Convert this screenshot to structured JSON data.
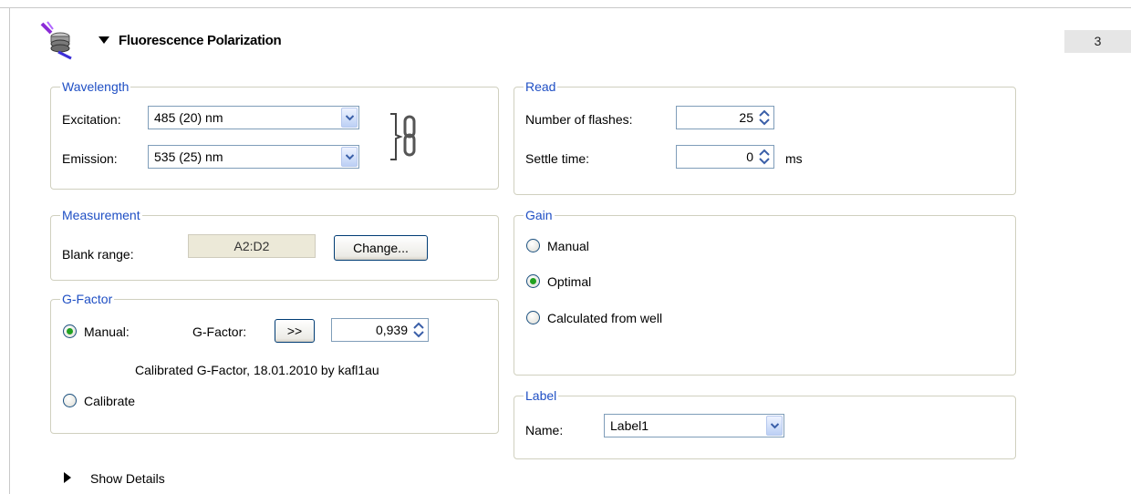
{
  "header": {
    "title": "Fluorescence Polarization",
    "step_number": "3",
    "icon": "fluorescence-lamp-icon"
  },
  "wavelength": {
    "legend": "Wavelength",
    "excitation_label": "Excitation:",
    "excitation_value": "485 (20) nm",
    "emission_label": "Emission:",
    "emission_value": "535 (25) nm",
    "link_icon": "chain-link-icon"
  },
  "measurement": {
    "legend": "Measurement",
    "blank_range_label": "Blank range:",
    "blank_range_value": "A2:D2",
    "change_button": "Change..."
  },
  "gfactor": {
    "legend": "G-Factor",
    "manual_label": "Manual:",
    "manual_selected": true,
    "gfactor_label": "G-Factor:",
    "apply_button": ">>",
    "gfactor_value": "0,939",
    "calibration_info": "Calibrated G-Factor, 18.01.2010 by kafl1au",
    "calibrate_label": "Calibrate",
    "calibrate_selected": false
  },
  "read": {
    "legend": "Read",
    "flashes_label": "Number of flashes:",
    "flashes_value": "25",
    "settle_label": "Settle time:",
    "settle_value": "0",
    "settle_unit": "ms"
  },
  "gain": {
    "legend": "Gain",
    "options": [
      {
        "label": "Manual",
        "selected": false
      },
      {
        "label": "Optimal",
        "selected": true
      },
      {
        "label": "Calculated from well",
        "selected": false
      }
    ]
  },
  "label_group": {
    "legend": "Label",
    "name_label": "Name:",
    "name_value": "Label1"
  },
  "footer": {
    "show_details": "Show Details"
  },
  "colors": {
    "legend_text": "#1f4fc4",
    "group_border": "#d0d0bf",
    "radio_selected": "#21a121"
  }
}
